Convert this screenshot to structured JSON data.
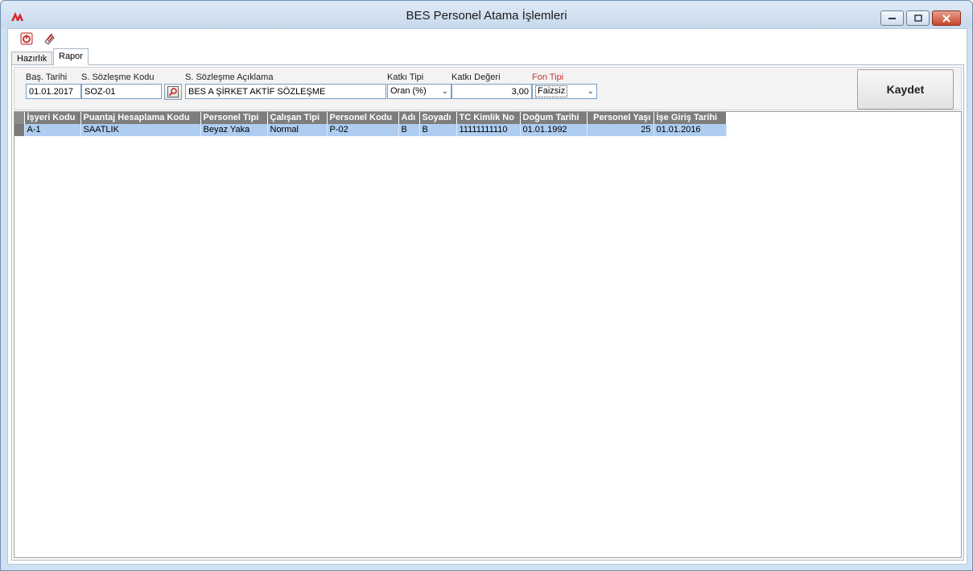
{
  "window": {
    "title": "BES Personel Atama İşlemleri"
  },
  "tabs": [
    {
      "label": "Hazırlık",
      "active": false
    },
    {
      "label": "Rapor",
      "active": true
    }
  ],
  "form": {
    "start_date": {
      "label": "Baş. Tarihi",
      "value": "01.01.2017"
    },
    "contract_code": {
      "label": "S. Sözleşme Kodu",
      "value": "SOZ-01"
    },
    "contract_desc": {
      "label": "S. Sözleşme Açıklama",
      "value": "BES A ŞİRKET AKTİF SÖZLEŞME"
    },
    "contribution_type": {
      "label": "Katkı Tipi",
      "value": "Oran (%)"
    },
    "contribution_value": {
      "label": "Katkı Değeri",
      "value": "3,00"
    },
    "fund_type": {
      "label": "Fon Tipi",
      "value": "Faizsiz",
      "label_color": "#c83232"
    },
    "save_label": "Kaydet"
  },
  "grid": {
    "columns": [
      "İşyeri Kodu",
      "Puantaj Hesaplama Kodu",
      "Personel Tipi",
      "Çalışan Tipi",
      "Personel Kodu",
      "Adı",
      "Soyadı",
      "TC Kimlik No",
      "Doğum Tarihi",
      "Personel Yaşı",
      "İşe Giriş Tarihi"
    ],
    "rows": [
      [
        "A-1",
        "SAATLIK",
        "Beyaz Yaka",
        "Normal",
        "P-02",
        "B",
        "B",
        "11111111110",
        "01.01.1992",
        "25",
        "01.01.2016"
      ]
    ]
  },
  "colors": {
    "selection": "#aecdf0",
    "header": "#7d7d7d"
  }
}
